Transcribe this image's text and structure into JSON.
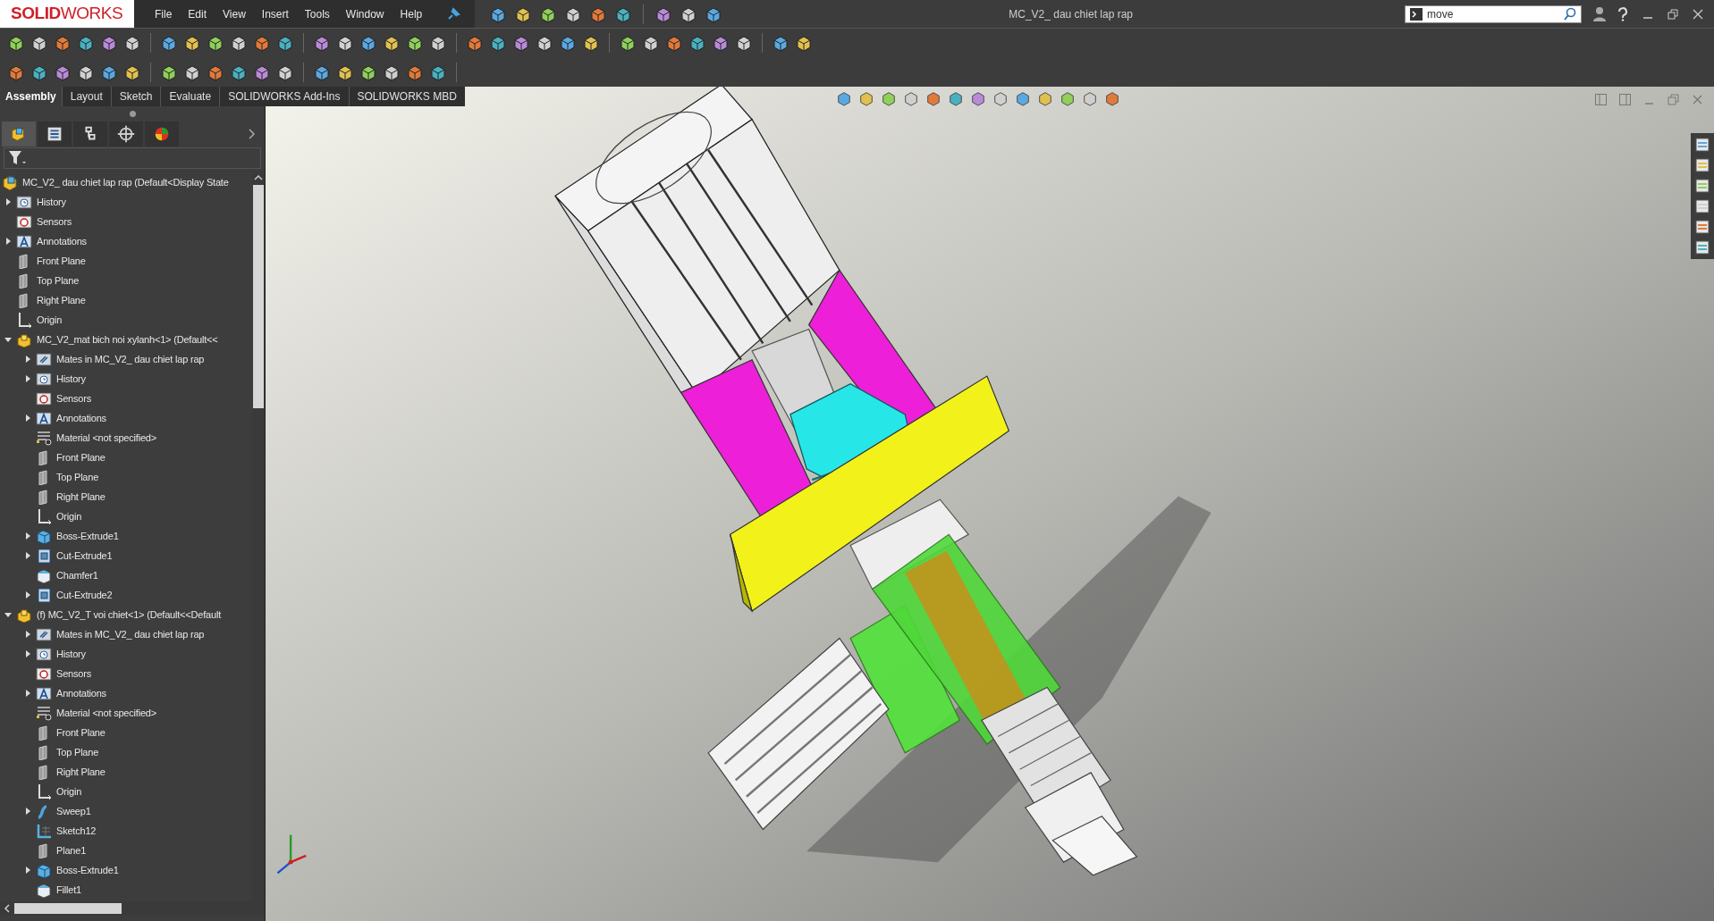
{
  "app": {
    "logo": "**SOLID**WORKS",
    "menu": [
      "File",
      "Edit",
      "View",
      "Insert",
      "Tools",
      "Window",
      "Help"
    ],
    "title": "MC_V2_ dau chiet lap rap",
    "search": {
      "value": "move"
    }
  },
  "command_tabs": [
    {
      "label": "Assembly",
      "selected": true
    },
    {
      "label": "Layout",
      "selected": false
    },
    {
      "label": "Sketch",
      "selected": false
    },
    {
      "label": "Evaluate",
      "selected": false
    },
    {
      "label": "SOLIDWORKS Add-Ins",
      "selected": false
    },
    {
      "label": "SOLIDWORKS MBD",
      "selected": false
    }
  ],
  "panel_tabs": [
    {
      "kind": "tree",
      "selected": true
    },
    {
      "kind": "properties",
      "selected": false
    },
    {
      "kind": "config",
      "selected": false
    },
    {
      "kind": "dim",
      "selected": false
    },
    {
      "kind": "appearance",
      "selected": false
    }
  ],
  "tree": {
    "root": {
      "label": "MC_V2_ dau chiet lap rap  (Default<Display State",
      "kind": "assembly"
    },
    "items": [
      {
        "label": "History",
        "kind": "history",
        "expanded": false
      },
      {
        "label": "Sensors",
        "kind": "sensors"
      },
      {
        "label": "Annotations",
        "kind": "annotations",
        "expanded": false
      },
      {
        "label": "Front Plane",
        "kind": "plane"
      },
      {
        "label": "Top Plane",
        "kind": "plane"
      },
      {
        "label": "Right Plane",
        "kind": "plane"
      },
      {
        "label": "Origin",
        "kind": "origin"
      },
      {
        "label": "MC_V2_mat bich noi xylanh<1> (Default<<",
        "kind": "part",
        "expanded": true,
        "children": [
          {
            "label": "Mates in MC_V2_ dau chiet lap rap",
            "kind": "mates",
            "expanded": false
          },
          {
            "label": "History",
            "kind": "history",
            "expanded": false
          },
          {
            "label": "Sensors",
            "kind": "sensors"
          },
          {
            "label": "Annotations",
            "kind": "annotations",
            "expanded": false
          },
          {
            "label": "Material <not specified>",
            "kind": "material"
          },
          {
            "label": "Front Plane",
            "kind": "plane"
          },
          {
            "label": "Top Plane",
            "kind": "plane"
          },
          {
            "label": "Right Plane",
            "kind": "plane"
          },
          {
            "label": "Origin",
            "kind": "origin"
          },
          {
            "label": "Boss-Extrude1",
            "kind": "extrude",
            "expanded": false
          },
          {
            "label": "Cut-Extrude1",
            "kind": "cut",
            "expanded": false
          },
          {
            "label": "Chamfer1",
            "kind": "fillet"
          },
          {
            "label": "Cut-Extrude2",
            "kind": "cut",
            "expanded": false
          }
        ]
      },
      {
        "label": "(f) MC_V2_T voi chiet<1> (Default<<Default",
        "kind": "part",
        "expanded": true,
        "children": [
          {
            "label": "Mates in MC_V2_ dau chiet lap rap",
            "kind": "mates",
            "expanded": false
          },
          {
            "label": "History",
            "kind": "history",
            "expanded": false
          },
          {
            "label": "Sensors",
            "kind": "sensors"
          },
          {
            "label": "Annotations",
            "kind": "annotations",
            "expanded": false
          },
          {
            "label": "Material <not specified>",
            "kind": "material"
          },
          {
            "label": "Front Plane",
            "kind": "plane"
          },
          {
            "label": "Top Plane",
            "kind": "plane"
          },
          {
            "label": "Right Plane",
            "kind": "plane"
          },
          {
            "label": "Origin",
            "kind": "origin"
          },
          {
            "label": "Sweep1",
            "kind": "sweep",
            "expanded": false
          },
          {
            "label": "Sketch12",
            "kind": "sketch"
          },
          {
            "label": "Plane1",
            "kind": "plane"
          },
          {
            "label": "Boss-Extrude1",
            "kind": "extrude",
            "expanded": false
          },
          {
            "label": "Fillet1",
            "kind": "fillet"
          }
        ]
      }
    ]
  }
}
